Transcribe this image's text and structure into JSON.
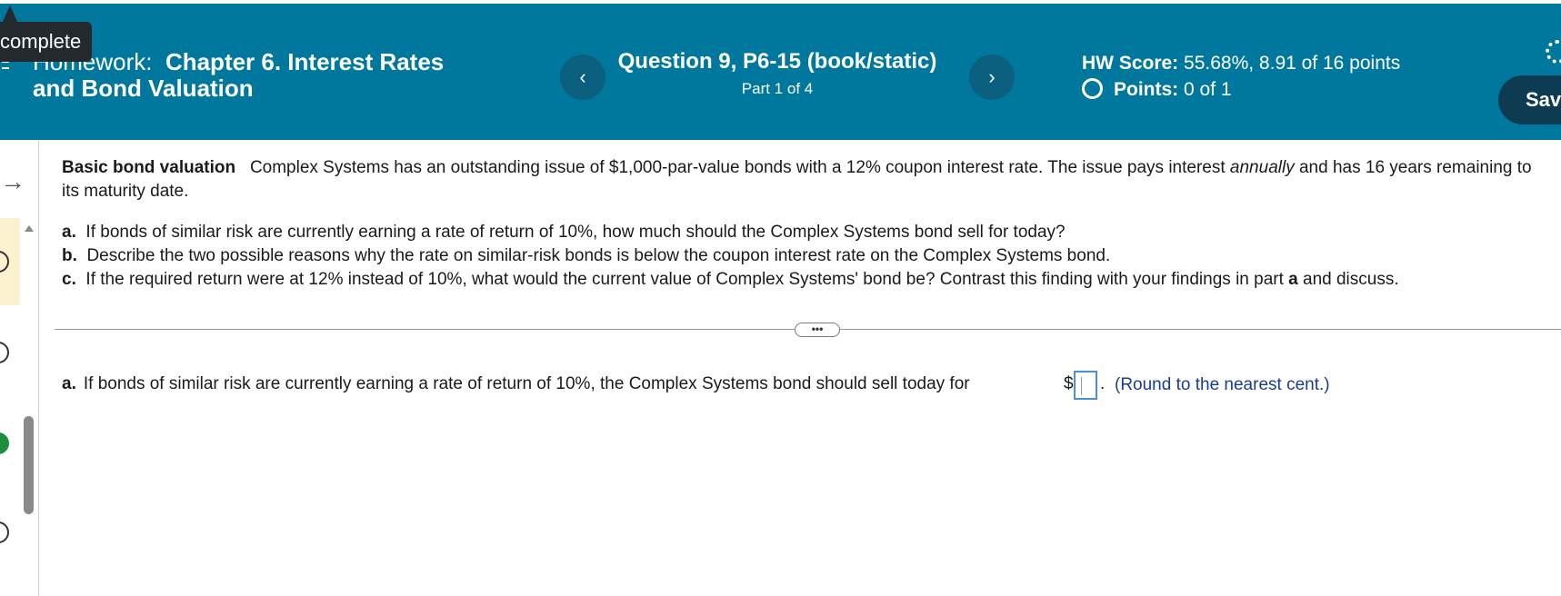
{
  "header": {
    "tooltip": "complete",
    "hw_prefix": "Homework:",
    "hw_title_line1": "Chapter 6. Interest Rates",
    "hw_title_line2": "and Bond Valuation",
    "question_title": "Question 9, P6-15 (book/static)",
    "question_part": "Part 1 of 4",
    "prev_icon": "‹",
    "next_icon": "›",
    "hw_score_label": "HW Score:",
    "hw_score_value": "55.68%, 8.91 of 16 points",
    "points_label": "Points:",
    "points_value": "0 of 1",
    "save_label": "Save"
  },
  "problem": {
    "heading": "Basic bond valuation",
    "text_1": "Complex Systems has an outstanding issue of $1,000-par-value bonds with a  12% coupon interest rate.  The issue pays interest ",
    "text_italic": "annually",
    "text_2": " and has 16 years remaining to its maturity date.",
    "parts": [
      {
        "label": "a.",
        "text": "If bonds of similar risk are currently earning a rate of return of 10%, how much should the Complex Systems bond sell for today?"
      },
      {
        "label": "b.",
        "text": "Describe the two possible reasons why the rate on similar-risk bonds is below the coupon interest rate on the Complex Systems bond."
      },
      {
        "label": "c.",
        "text_1": "If the required return were at 12% instead of 10%, what would the current value of Complex Systems' bond be?  Contrast this finding with your findings in part ",
        "bold": "a",
        "text_2": " and discuss."
      }
    ]
  },
  "answer": {
    "label": "a.",
    "text": "If bonds of similar risk are currently earning a rate of return of 10%, the Complex Systems bond should sell today for",
    "currency": "$",
    "value": "",
    "period": ".",
    "note": "(Round to the nearest cent.)"
  },
  "divider_button": "•••"
}
